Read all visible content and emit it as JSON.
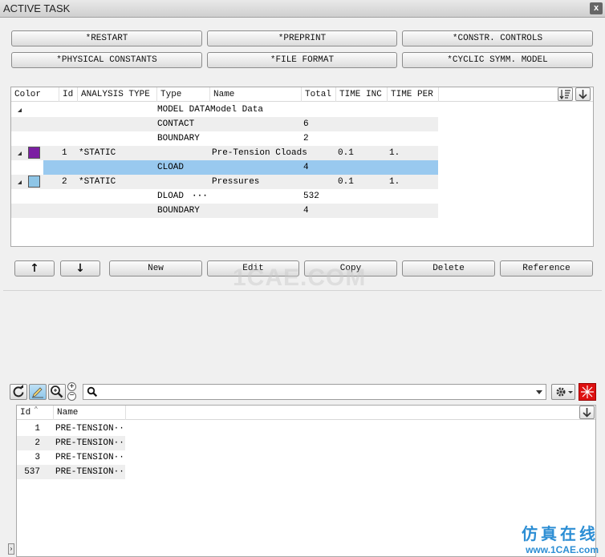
{
  "window": {
    "title": "ACTIVE TASK",
    "close_glyph": "x"
  },
  "top_buttons": [
    {
      "label": "*RESTART"
    },
    {
      "label": "*PREPRINT"
    },
    {
      "label": "*CONSTR. CONTROLS"
    },
    {
      "label": "*PHYSICAL CONSTANTS"
    },
    {
      "label": "*FILE FORMAT"
    },
    {
      "label": "*CYCLIC SYMM. MODEL"
    }
  ],
  "tree": {
    "columns": [
      "Color",
      "Id",
      "ANALYSIS TYPE",
      "Type",
      "Name",
      "Total",
      "TIME INC",
      "TIME PER"
    ],
    "rows": [
      {
        "expand": true,
        "color": "",
        "id": "",
        "analysis": "",
        "type": "MODEL DATA",
        "name": "Model Data",
        "total": "",
        "inc": "",
        "per": ""
      },
      {
        "expand": false,
        "color": "",
        "id": "",
        "analysis": "",
        "type": "CONTACT",
        "name": "",
        "total": "6",
        "inc": "",
        "per": ""
      },
      {
        "expand": false,
        "color": "",
        "id": "",
        "analysis": "",
        "type": "BOUNDARY",
        "name": "",
        "total": "2",
        "inc": "",
        "per": ""
      },
      {
        "expand": true,
        "color": "#7b1fa2",
        "id": "1",
        "analysis": "*STATIC",
        "type": "",
        "name": "Pre-Tension Cloads",
        "total": "",
        "inc": "0.1",
        "per": "1."
      },
      {
        "expand": false,
        "color": "",
        "id": "",
        "analysis": "",
        "type": "CLOAD",
        "name": "",
        "total": "4",
        "inc": "",
        "per": "",
        "selected": true
      },
      {
        "expand": true,
        "color": "#8ec5e6",
        "id": "2",
        "analysis": "*STATIC",
        "type": "",
        "name": "Pressures",
        "total": "",
        "inc": "0.1",
        "per": "1."
      },
      {
        "expand": false,
        "color": "",
        "id": "",
        "analysis": "",
        "type": "DLOAD",
        "name": "",
        "total": "532",
        "inc": "",
        "per": "",
        "ellipsis": "···"
      },
      {
        "expand": false,
        "color": "",
        "id": "",
        "analysis": "",
        "type": "BOUNDARY",
        "name": "",
        "total": "4",
        "inc": "",
        "per": ""
      }
    ]
  },
  "action_buttons": {
    "up": "↑",
    "down": "↓",
    "new": "New",
    "edit": "Edit",
    "copy": "Copy",
    "delete": "Delete",
    "reference": "Reference"
  },
  "watermark": "1CAE.COM",
  "list": {
    "columns": [
      "Id",
      "Name"
    ],
    "rows": [
      {
        "id": "1",
        "name": "PRE-TENSION··"
      },
      {
        "id": "2",
        "name": "PRE-TENSION··"
      },
      {
        "id": "3",
        "name": "PRE-TENSION··"
      },
      {
        "id": "537",
        "name": "PRE-TENSION··"
      }
    ]
  },
  "search": {
    "placeholder": ""
  },
  "brand": {
    "cn": "仿真在线",
    "url": "www.1CAE.com"
  },
  "icons": {
    "refresh": "refresh-icon",
    "highlight": "highlight-icon",
    "zoom": "zoom-icon",
    "search": "search-icon",
    "settings": "gear-icon",
    "sort": "sort-icon",
    "collapse": "arrow-down-icon"
  }
}
